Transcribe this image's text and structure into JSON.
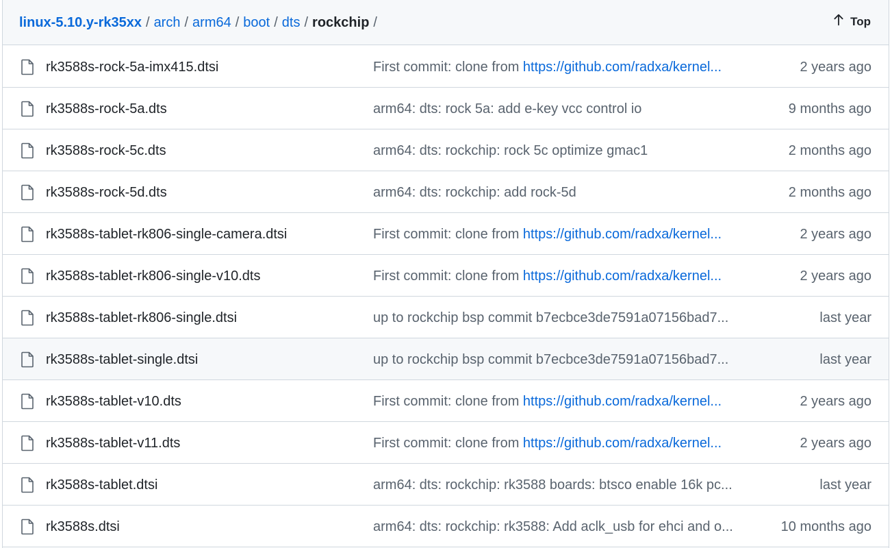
{
  "breadcrumb": {
    "repo": "linux-5.10.y-rk35xx",
    "segments": [
      "arch",
      "arm64",
      "boot",
      "dts"
    ],
    "current": "rockchip",
    "separator": "/"
  },
  "top_button": {
    "label": "Top",
    "icon": "arrow-up-icon"
  },
  "files": [
    {
      "name": "rk3588s-rock-5a-imx415.dtsi",
      "commit_text": "First commit: clone from ",
      "commit_link": "https://github.com/radxa/kernel...",
      "age": "2 years ago"
    },
    {
      "name": "rk3588s-rock-5a.dts",
      "commit_text": "arm64: dts: rock 5a: add e-key vcc control io",
      "commit_link": "",
      "age": "9 months ago"
    },
    {
      "name": "rk3588s-rock-5c.dts",
      "commit_text": "arm64: dts: rockchip: rock 5c optimize gmac1",
      "commit_link": "",
      "age": "2 months ago"
    },
    {
      "name": "rk3588s-rock-5d.dts",
      "commit_text": "arm64: dts: rockchip: add rock-5d",
      "commit_link": "",
      "age": "2 months ago"
    },
    {
      "name": "rk3588s-tablet-rk806-single-camera.dtsi",
      "commit_text": "First commit: clone from ",
      "commit_link": "https://github.com/radxa/kernel...",
      "age": "2 years ago"
    },
    {
      "name": "rk3588s-tablet-rk806-single-v10.dts",
      "commit_text": "First commit: clone from ",
      "commit_link": "https://github.com/radxa/kernel...",
      "age": "2 years ago"
    },
    {
      "name": "rk3588s-tablet-rk806-single.dtsi",
      "commit_text": "up to rockchip bsp commit b7ecbce3de7591a07156bad7...",
      "commit_link": "",
      "age": "last year"
    },
    {
      "name": "rk3588s-tablet-single.dtsi",
      "commit_text": "up to rockchip bsp commit b7ecbce3de7591a07156bad7...",
      "commit_link": "",
      "age": "last year",
      "hover": true
    },
    {
      "name": "rk3588s-tablet-v10.dts",
      "commit_text": "First commit: clone from ",
      "commit_link": "https://github.com/radxa/kernel...",
      "age": "2 years ago"
    },
    {
      "name": "rk3588s-tablet-v11.dts",
      "commit_text": "First commit: clone from ",
      "commit_link": "https://github.com/radxa/kernel...",
      "age": "2 years ago"
    },
    {
      "name": "rk3588s-tablet.dtsi",
      "commit_text": "arm64: dts: rockchip: rk3588 boards: btsco enable 16k pc...",
      "commit_link": "",
      "age": "last year"
    },
    {
      "name": "rk3588s.dtsi",
      "commit_text": "arm64: dts: rockchip: rk3588: Add aclk_usb for ehci and o...",
      "commit_link": "",
      "age": "10 months ago"
    }
  ],
  "colors": {
    "link": "#0969da",
    "muted": "#59636e",
    "header_bg": "#f6f8fa",
    "border": "#d0d7de"
  }
}
